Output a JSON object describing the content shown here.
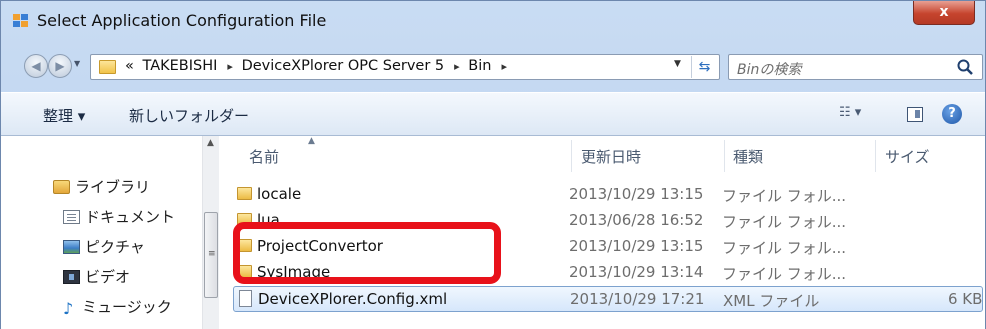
{
  "window": {
    "title": "Select Application Configuration File",
    "close_label": "x"
  },
  "address": {
    "breadcrumb_prefix": "«",
    "crumbs": [
      "TAKEBISHI",
      "DeviceXPlorer OPC Server 5",
      "Bin"
    ],
    "separator": "▸"
  },
  "search": {
    "placeholder": "Binの検索"
  },
  "toolbar": {
    "organize_label": "整理 ▾",
    "new_folder_label": "新しいフォルダー",
    "views_label": "☷ ▾",
    "help_label": "?"
  },
  "navpane": {
    "items": [
      {
        "label": "ライブラリ",
        "icon": "library-icon"
      },
      {
        "label": "ドキュメント",
        "icon": "documents-icon"
      },
      {
        "label": "ピクチャ",
        "icon": "pictures-icon"
      },
      {
        "label": "ビデオ",
        "icon": "videos-icon"
      },
      {
        "label": "ミュージック",
        "icon": "music-icon"
      }
    ]
  },
  "columns": {
    "name": "名前",
    "date": "更新日時",
    "type": "種類",
    "size": "サイズ"
  },
  "files": [
    {
      "name": "locale",
      "date": "2013/10/29 13:15",
      "type": "ファイル フォル...",
      "size": "",
      "kind": "folder"
    },
    {
      "name": "lua",
      "date": "2013/06/28 16:52",
      "type": "ファイル フォル...",
      "size": "",
      "kind": "folder"
    },
    {
      "name": "ProjectConvertor",
      "date": "2013/10/29 13:15",
      "type": "ファイル フォル...",
      "size": "",
      "kind": "folder"
    },
    {
      "name": "SysImage",
      "date": "2013/10/29 13:14",
      "type": "ファイル フォル...",
      "size": "",
      "kind": "folder"
    },
    {
      "name": "DeviceXPlorer.Config.xml",
      "date": "2013/10/29 17:21",
      "type": "XML ファイル",
      "size": "6 KB",
      "kind": "xml",
      "selected": true
    }
  ],
  "colors": {
    "highlight": "#e8111a",
    "selection": "#d6e7fb"
  }
}
